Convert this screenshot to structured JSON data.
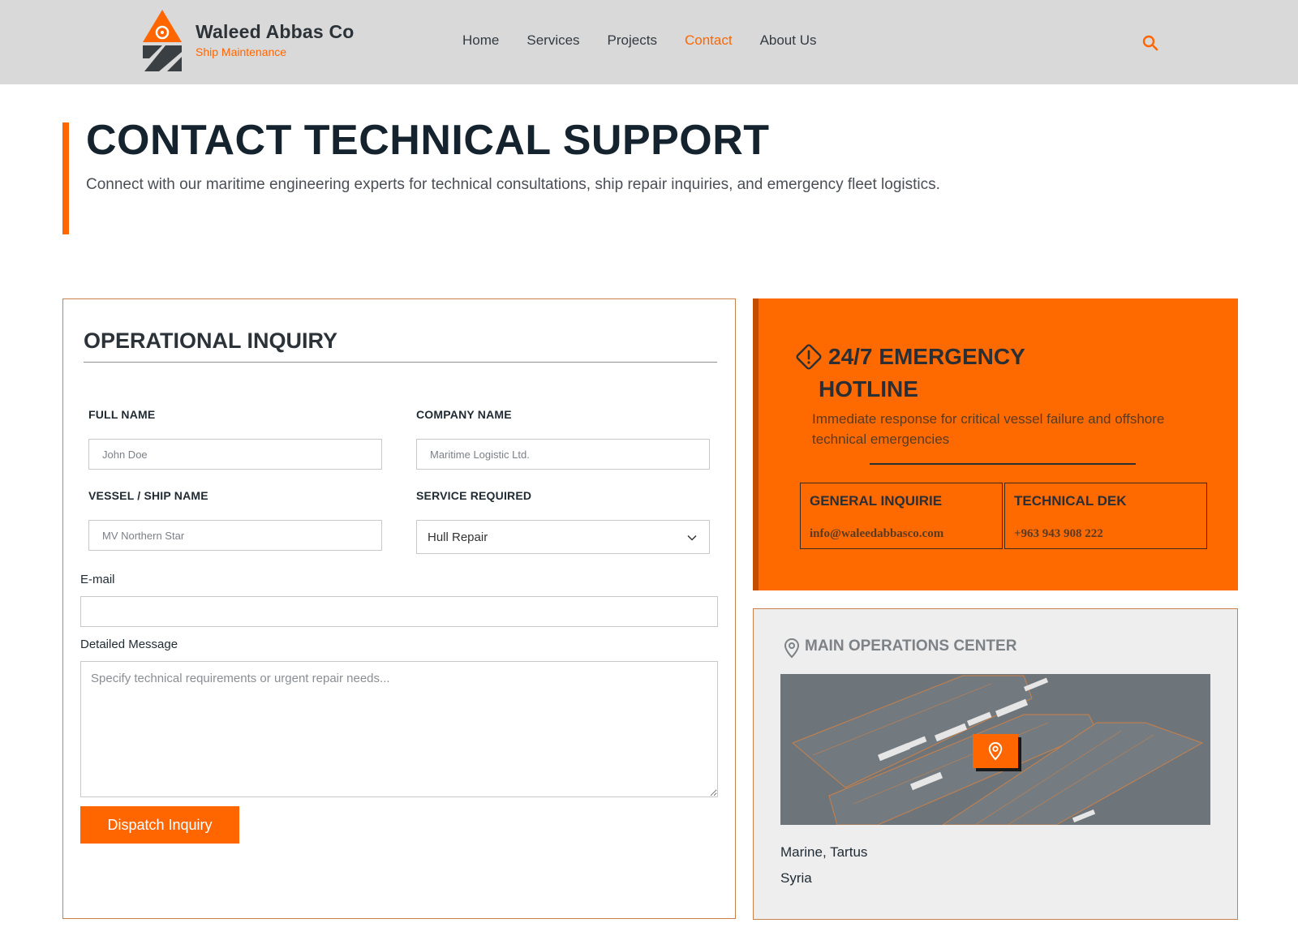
{
  "brand": {
    "name": "Waleed Abbas Co",
    "tagline": "Ship Maintenance",
    "logo_icon": "gear-anchor-logo-icon"
  },
  "nav": {
    "items": [
      {
        "label": "Home",
        "active": false
      },
      {
        "label": "Services",
        "active": false
      },
      {
        "label": "Projects",
        "active": false
      },
      {
        "label": "Contact",
        "active": true
      },
      {
        "label": "About Us",
        "active": false
      }
    ],
    "search_icon": "search-icon"
  },
  "hero": {
    "title": "CONTACT TECHNICAL SUPPORT",
    "subtitle": "Connect with our maritime engineering experts for technical consultations, ship repair inquiries, and emergency fleet logistics."
  },
  "form": {
    "title": "OPERATIONAL INQUIRY",
    "full_name": {
      "label": "FULL NAME",
      "placeholder": "John Doe",
      "value": ""
    },
    "company_name": {
      "label": "COMPANY NAME",
      "placeholder": "Maritime Logistic Ltd.",
      "value": ""
    },
    "vessel_name": {
      "label": "VESSEL / SHIP NAME",
      "placeholder": "MV Northern Star",
      "value": ""
    },
    "service": {
      "label": "SERVICE REQUIRED",
      "selected": "Hull Repair"
    },
    "email": {
      "label": "E-mail",
      "placeholder": "",
      "value": ""
    },
    "message": {
      "label": "Detailed Message",
      "placeholder": "Specify technical requirements or urgent repair needs..."
    },
    "submit_label": "Dispatch Inquiry"
  },
  "emergency": {
    "title_line1": "24/7 EMERGENCY",
    "title_line2": "HOTLINE",
    "description": "Immediate response for critical vessel failure and offshore technical emergencies",
    "general": {
      "heading": "GENERAL INQUIRIE",
      "value": "info@waleedabbasco.com"
    },
    "technical": {
      "heading": "TECHNICAL DEK",
      "value": "+963 943 908 222"
    }
  },
  "location": {
    "title": "MAIN OPERATIONS CENTER",
    "line1": "Marine, Tartus",
    "line2": "Syria"
  },
  "colors": {
    "accent": "#ff6600",
    "header_bg": "#d9d9d9",
    "dark_text": "#14232e"
  }
}
